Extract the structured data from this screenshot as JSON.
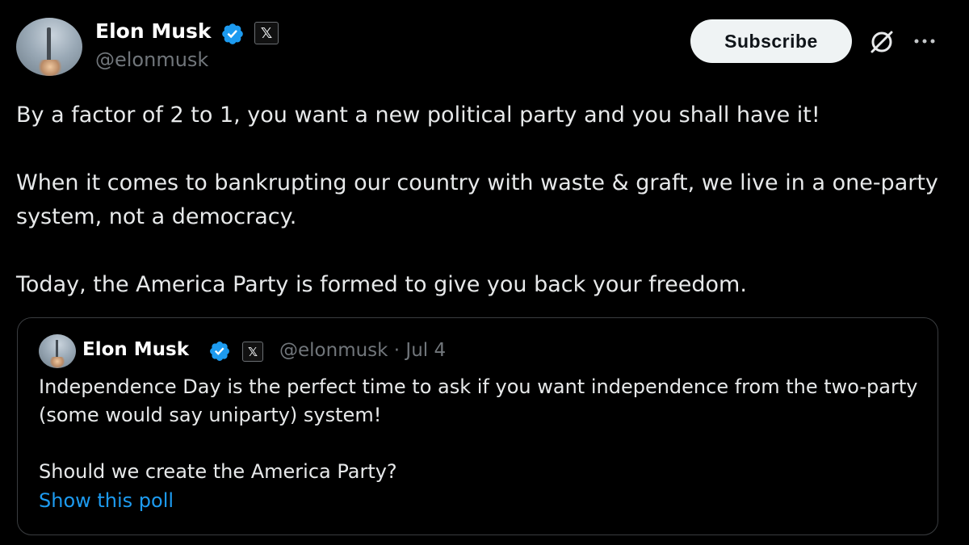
{
  "post": {
    "author": {
      "name": "Elon Musk",
      "handle": "@elonmusk",
      "badge_icon": "verified-check-icon",
      "affiliate_icon": "x-logo-icon"
    },
    "actions": {
      "subscribe_label": "Subscribe",
      "grok_icon": "grok-icon",
      "more_icon": "more-options-icon"
    },
    "text": "By a factor of 2 to 1, you want a new political party and you shall have it!\n\nWhen it comes to bankrupting our country with waste & graft, we live in a one-party system, not a democracy.\n\nToday, the America Party is formed to give you back your freedom."
  },
  "quoted_post": {
    "author": {
      "name": "Elon Musk",
      "handle": "@elonmusk",
      "separator": "·",
      "date": "Jul 4"
    },
    "text": "Independence Day is the perfect time to ask if you want independence from the two-party (some would say uniparty) system!\n\nShould we create the America Party?",
    "link_label": "Show this poll"
  },
  "colors": {
    "background": "#000000",
    "text": "#e7e9ea",
    "muted": "#71767b",
    "link": "#1d9bf0",
    "verified": "#1d9bf0",
    "button_bg": "#eff3f4"
  }
}
